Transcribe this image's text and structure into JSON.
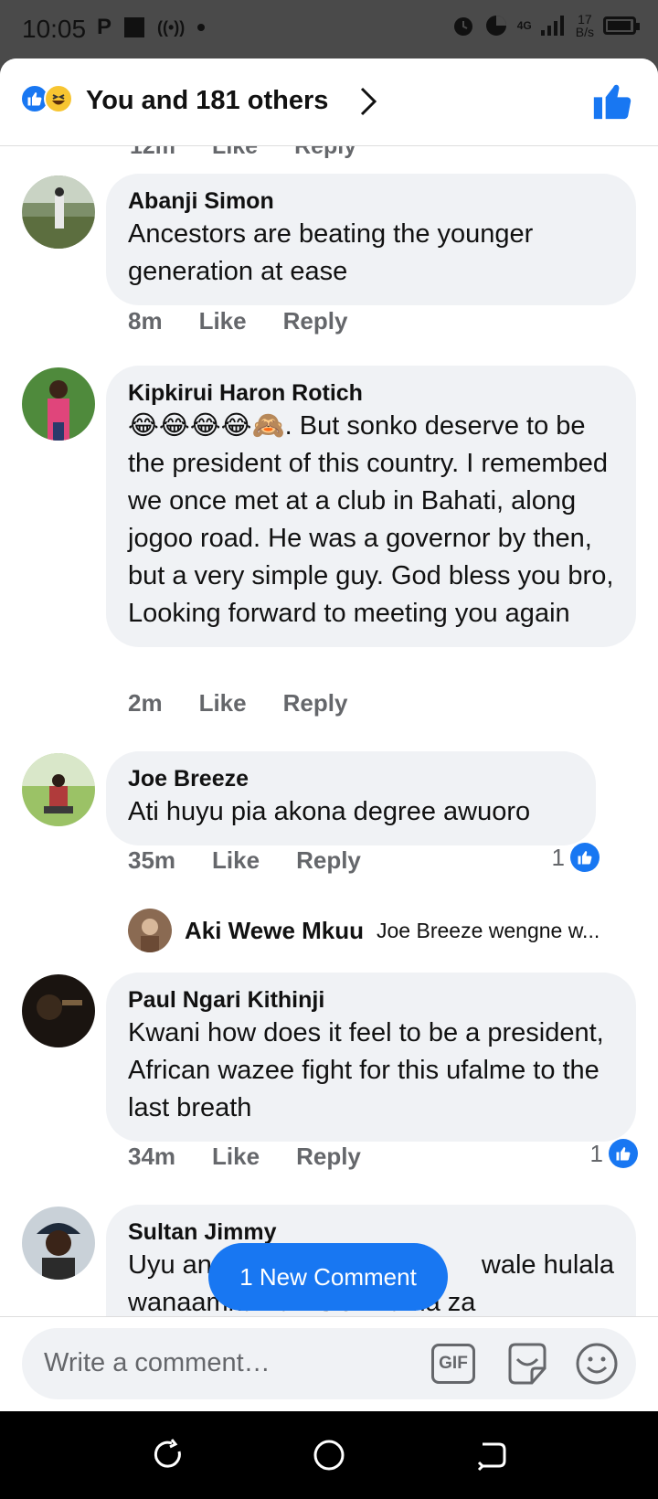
{
  "status_bar": {
    "time": "10:05",
    "network_speed_value": "17",
    "network_speed_unit": "B/s",
    "signal_label": "4G",
    "battery_level": 0.95
  },
  "header": {
    "reactions_text": "You and 181 others",
    "reaction_icons": [
      "like-icon",
      "haha-icon"
    ]
  },
  "previous_comment_meta": {
    "time": "12m",
    "like": "Like",
    "reply": "Reply"
  },
  "comments": [
    {
      "name": "Abanji Simon",
      "text": "Ancestors are beating the younger generation at ease",
      "time": "8m",
      "like": "Like",
      "reply": "Reply"
    },
    {
      "name": "Kipkirui Haron Rotich",
      "emoji": "😂😂😂😂🙈",
      "text": ". But sonko deserve to be the president of this country. I remembed we once met at a club in Bahati, along jogoo road. He was a governor by then, but a very simple guy. God bless you bro, Looking forward to meeting you again",
      "time": "2m",
      "like": "Like",
      "reply": "Reply"
    },
    {
      "name": "Joe Breeze",
      "text": "Ati huyu pia akona degree awuoro",
      "time": "35m",
      "like": "Like",
      "reply": "Reply",
      "like_count": "1",
      "reply_preview": {
        "name": "Aki Wewe Mkuu",
        "text": "Joe Breeze wengne w..."
      }
    },
    {
      "name": "Paul Ngari Kithinji",
      "text": "Kwani how does it feel to be a president, African wazee fight for this ufalme to the last breath",
      "time": "34m",
      "like": "Like",
      "reply": "Reply",
      "like_count": "1"
    },
    {
      "name": "Sultan Jimmy",
      "text_line1_left": "Uyu an",
      "text_line1_right": "wale hulala",
      "text_line2": "wanaamka na vision kama za"
    }
  ],
  "new_comment_button": "1 New Comment",
  "composer": {
    "placeholder": "Write a comment…",
    "gif_label": "GIF"
  },
  "colors": {
    "facebook_blue": "#1877f2",
    "bubble_gray": "#f0f2f5",
    "meta_gray": "#65676b"
  }
}
